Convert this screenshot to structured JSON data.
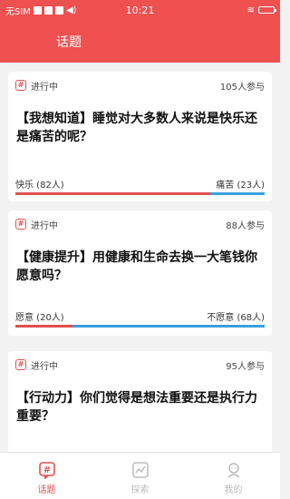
{
  "status_bar": {
    "carrier": "无SIM",
    "time": "10:21"
  },
  "header": {
    "title": "话题"
  },
  "colors": {
    "accent": "#ef5050",
    "option_a": "#e05050",
    "option_b": "#3aa0dd"
  },
  "topics": [
    {
      "status": "进行中",
      "participants": "105人参与",
      "title": "【我想知道】睡觉对大多数人来说是快乐还是痛苦的呢？",
      "option_a": "快乐 (82人)",
      "option_b": "痛苦 (23人)",
      "share_a": 0.78
    },
    {
      "status": "进行中",
      "participants": "88人参与",
      "title": "【健康提升】用健康和生命去换一大笔钱你愿意吗？",
      "option_a": "愿意 (20人)",
      "option_b": "不愿意 (68人)",
      "share_a": 0.23
    },
    {
      "status": "进行中",
      "participants": "95人参与",
      "title": "【行动力】你们觉得是想法重要还是执行力重要？"
    }
  ],
  "tabbar": {
    "items": [
      {
        "label": "话题",
        "icon": "topic-icon",
        "active": true
      },
      {
        "label": "探索",
        "icon": "explore-chart-icon",
        "active": false
      },
      {
        "label": "我的",
        "icon": "profile-icon",
        "active": false
      }
    ]
  }
}
